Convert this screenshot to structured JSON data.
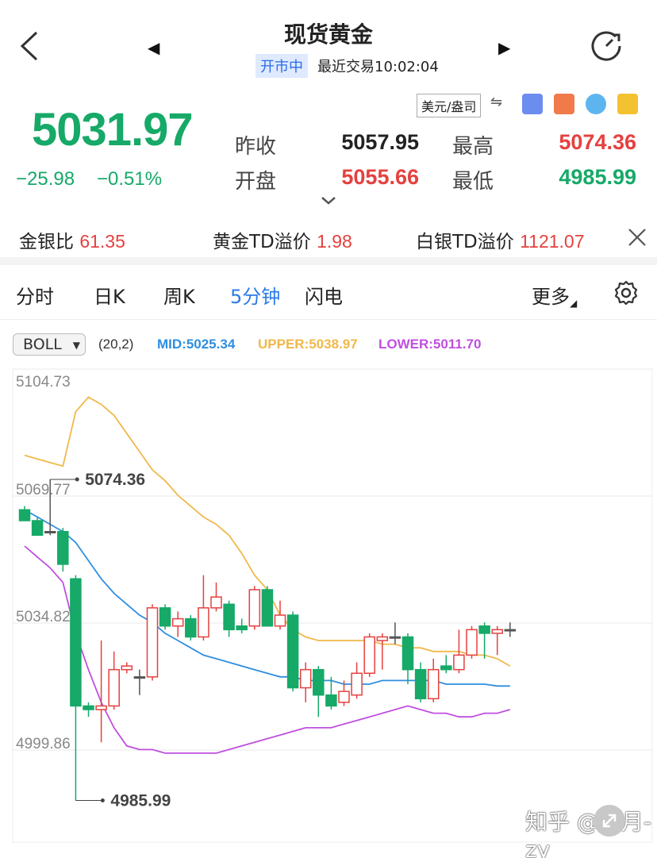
{
  "header": {
    "title": "现货黄金",
    "status_badge": "开市中",
    "last_trade": "最近交易10:02:04",
    "prev_icon": "left-triangle-icon",
    "next_icon": "right-triangle-icon"
  },
  "quote": {
    "price": "5031.97",
    "change": "−25.98",
    "change_pct": "−0.51%",
    "prev_close_label": "昨收",
    "prev_close": "5057.95",
    "open_label": "开盘",
    "open": "5055.66",
    "high_label": "最高",
    "high": "5074.36",
    "low_label": "最低",
    "low": "4985.99",
    "currency": "美元/盎司",
    "swap_symbol": "⇋"
  },
  "ratio_row": {
    "gold_silver_label": "金银比",
    "gold_silver": "61.35",
    "gold_td_label": "黄金TD溢价",
    "gold_td": "1.98",
    "silver_td_label": "白银TD溢价",
    "silver_td": "1121.07"
  },
  "tabs": {
    "t1": "分时",
    "t2": "日K",
    "t3": "周K",
    "t4": "5分钟",
    "t5": "闪电",
    "more": "更多"
  },
  "indicator": {
    "name": "BOLL",
    "params": "(20,2)",
    "mid": "MID:5025.34",
    "upper": "UPPER:5038.97",
    "lower": "LOWER:5011.70"
  },
  "watermark": "知乎 @赵月-zy",
  "colors": {
    "up": "#e5413f",
    "down": "#16a968",
    "mid": "#2e8ee0",
    "upper": "#f0b84a",
    "lower": "#c04fe0",
    "accent": "#2b7be8"
  },
  "chart_data": {
    "type": "candlestick",
    "y_ticks": [
      5104.73,
      5069.77,
      5034.81,
      4999.86
    ],
    "y_tick_labels": [
      "5104.73",
      "5069.77",
      "5034.82",
      "4999.86"
    ],
    "ylim": [
      4990,
      5106
    ],
    "high_marker": {
      "value": 5074.36,
      "label": "5074.36",
      "index": 2
    },
    "low_marker": {
      "value": 4985.99,
      "label": "4985.99",
      "index": 4
    },
    "candles": [
      {
        "o": 5066,
        "h": 5067,
        "l": 5063,
        "c": 5063
      },
      {
        "o": 5063,
        "h": 5064,
        "l": 5059,
        "c": 5059
      },
      {
        "o": 5060,
        "h": 5074.36,
        "l": 5059,
        "c": 5060
      },
      {
        "o": 5060,
        "h": 5061,
        "l": 5049,
        "c": 5051
      },
      {
        "o": 5047,
        "h": 5048,
        "l": 4985.99,
        "c": 5012
      },
      {
        "o": 5012,
        "h": 5013,
        "l": 5009,
        "c": 5011
      },
      {
        "o": 5011,
        "h": 5030,
        "l": 5002,
        "c": 5012
      },
      {
        "o": 5012,
        "h": 5027,
        "l": 5011,
        "c": 5022
      },
      {
        "o": 5022,
        "h": 5024,
        "l": 5021,
        "c": 5023
      },
      {
        "o": 5020,
        "h": 5022,
        "l": 5015,
        "c": 5020
      },
      {
        "o": 5020,
        "h": 5040,
        "l": 5019,
        "c": 5039
      },
      {
        "o": 5039,
        "h": 5040,
        "l": 5033,
        "c": 5034
      },
      {
        "o": 5034,
        "h": 5038,
        "l": 5031,
        "c": 5036
      },
      {
        "o": 5036,
        "h": 5037,
        "l": 5030,
        "c": 5031
      },
      {
        "o": 5031,
        "h": 5048,
        "l": 5030,
        "c": 5039
      },
      {
        "o": 5039,
        "h": 5046,
        "l": 5038,
        "c": 5042
      },
      {
        "o": 5040,
        "h": 5041,
        "l": 5031,
        "c": 5033
      },
      {
        "o": 5034,
        "h": 5036,
        "l": 5032,
        "c": 5033
      },
      {
        "o": 5034,
        "h": 5045,
        "l": 5033,
        "c": 5044
      },
      {
        "o": 5044,
        "h": 5045,
        "l": 5034,
        "c": 5034
      },
      {
        "o": 5034,
        "h": 5041,
        "l": 5033,
        "c": 5037
      },
      {
        "o": 5037,
        "h": 5038,
        "l": 5016,
        "c": 5017
      },
      {
        "o": 5017,
        "h": 5024,
        "l": 5013,
        "c": 5022
      },
      {
        "o": 5022,
        "h": 5023,
        "l": 5009,
        "c": 5015
      },
      {
        "o": 5015,
        "h": 5020,
        "l": 5011,
        "c": 5012
      },
      {
        "o": 5013,
        "h": 5019,
        "l": 5012,
        "c": 5016
      },
      {
        "o": 5015,
        "h": 5024,
        "l": 5014,
        "c": 5021
      },
      {
        "o": 5021,
        "h": 5032,
        "l": 5020,
        "c": 5031
      },
      {
        "o": 5030,
        "h": 5032,
        "l": 5022,
        "c": 5031
      },
      {
        "o": 5031,
        "h": 5035,
        "l": 5029,
        "c": 5031
      },
      {
        "o": 5031,
        "h": 5032,
        "l": 5018,
        "c": 5022
      },
      {
        "o": 5022,
        "h": 5024,
        "l": 5013,
        "c": 5014
      },
      {
        "o": 5014,
        "h": 5025,
        "l": 5013,
        "c": 5022
      },
      {
        "o": 5023,
        "h": 5026,
        "l": 5021,
        "c": 5022
      },
      {
        "o": 5022,
        "h": 5033,
        "l": 5021,
        "c": 5026
      },
      {
        "o": 5026,
        "h": 5034,
        "l": 5025,
        "c": 5033
      },
      {
        "o": 5034,
        "h": 5035,
        "l": 5025,
        "c": 5032
      },
      {
        "o": 5032,
        "h": 5034,
        "l": 5026,
        "c": 5033
      },
      {
        "o": 5033,
        "h": 5035,
        "l": 5031,
        "c": 5033
      }
    ],
    "mid": [
      5066,
      5064,
      5062,
      5060,
      5057,
      5052,
      5047,
      5043,
      5040,
      5037,
      5035,
      5032,
      5030,
      5028,
      5026,
      5025,
      5024,
      5023,
      5022,
      5021,
      5020,
      5020,
      5019,
      5019,
      5019,
      5018,
      5018,
      5018,
      5019,
      5019,
      5019,
      5019,
      5019,
      5018,
      5018,
      5018,
      5018,
      5017.5,
      5017.5
    ],
    "upper": [
      5081,
      5080,
      5079,
      5078,
      5093,
      5097,
      5095,
      5092,
      5087,
      5082,
      5077,
      5074,
      5070,
      5067,
      5064,
      5062,
      5059,
      5054,
      5048,
      5044,
      5037,
      5033,
      5031,
      5030,
      5030,
      5030,
      5030,
      5030,
      5029,
      5029,
      5028,
      5028,
      5027,
      5027,
      5027,
      5026,
      5026,
      5025,
      5023
    ],
    "lower": [
      5056,
      5053,
      5050,
      5046,
      5032,
      5022,
      5013,
      5006,
      5001,
      5000,
      5000,
      4999,
      4999,
      4999,
      4999,
      4999,
      5000,
      5001,
      5002,
      5003,
      5004,
      5005,
      5006,
      5006,
      5006,
      5007,
      5008,
      5009,
      5010,
      5011,
      5012,
      5011,
      5010,
      5010,
      5009,
      5009,
      5010,
      5010,
      5011
    ]
  }
}
